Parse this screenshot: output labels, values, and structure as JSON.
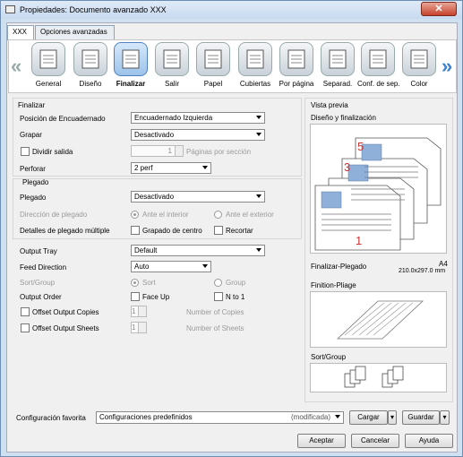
{
  "window": {
    "title": "Propiedades: Documento avanzado XXX",
    "close": "✕"
  },
  "tabs": [
    "XXX",
    "Opciones avanzadas"
  ],
  "toolbar": [
    {
      "label": "General",
      "icon": "general-icon"
    },
    {
      "label": "Diseño",
      "icon": "layout-icon"
    },
    {
      "label": "Finalizar",
      "icon": "finishing-icon",
      "selected": true
    },
    {
      "label": "Salir",
      "icon": "output-icon"
    },
    {
      "label": "Papel",
      "icon": "paper-icon"
    },
    {
      "label": "Cubiertas",
      "icon": "covers-icon"
    },
    {
      "label": "Por página",
      "icon": "per-page-icon"
    },
    {
      "label": "Separad.",
      "icon": "separators-icon"
    },
    {
      "label": "Conf. de sep.",
      "icon": "sep-settings-icon"
    },
    {
      "label": "Color",
      "icon": "color-icon"
    }
  ],
  "finalizar": {
    "group": "Finalizar",
    "binding_label": "Posición de Encuadernado",
    "binding_value": "Encuadernado Izquierda",
    "staple_label": "Grapar",
    "staple_value": "Desactivado",
    "split_label": "Dividir salida",
    "split_value": "1",
    "split_unit": "Páginas por sección",
    "punch_label": "Perforar",
    "punch_value": "2 perf"
  },
  "plegado": {
    "group": "Plegado",
    "fold_label": "Plegado",
    "fold_value": "Desactivado",
    "dir_label": "Dirección de plegado",
    "dir_inside": "Ante el interior",
    "dir_outside": "Ante el exterior",
    "details_label": "Detalles de plegado múltiple",
    "center_staple": "Grapado de centro",
    "trim": "Recortar"
  },
  "output": {
    "tray_label": "Output Tray",
    "tray_value": "Default",
    "feed_label": "Feed Direction",
    "feed_value": "Auto",
    "sortgroup_label": "Sort/Group",
    "sort": "Sort",
    "group": "Group",
    "order_label": "Output Order",
    "faceup": "Face Up",
    "nto1": "N to 1",
    "offset_copies": "Offset Output Copies",
    "offset_copies_value": "1",
    "offset_copies_unit": "Number of Copies",
    "offset_sheets": "Offset Output Sheets",
    "offset_sheets_value": "1",
    "offset_sheets_unit": "Number of Sheets"
  },
  "preview": {
    "title": "Vista previa",
    "design_label": "Diseño y finalización",
    "pages": [
      "5",
      "3",
      "1"
    ],
    "caption": "Finalizar-Plegado",
    "paper": "A4",
    "size": "210.0x297.0 mm",
    "finition": "Finition-Pliage",
    "sortgroup": "Sort/Group"
  },
  "bottom": {
    "fav_label": "Configuración favorita",
    "fav_value": "Configuraciones predefinidos",
    "fav_state": "(modificada)",
    "load": "Cargar",
    "save": "Guardar",
    "ok": "Aceptar",
    "cancel": "Cancelar",
    "help": "Ayuda"
  }
}
